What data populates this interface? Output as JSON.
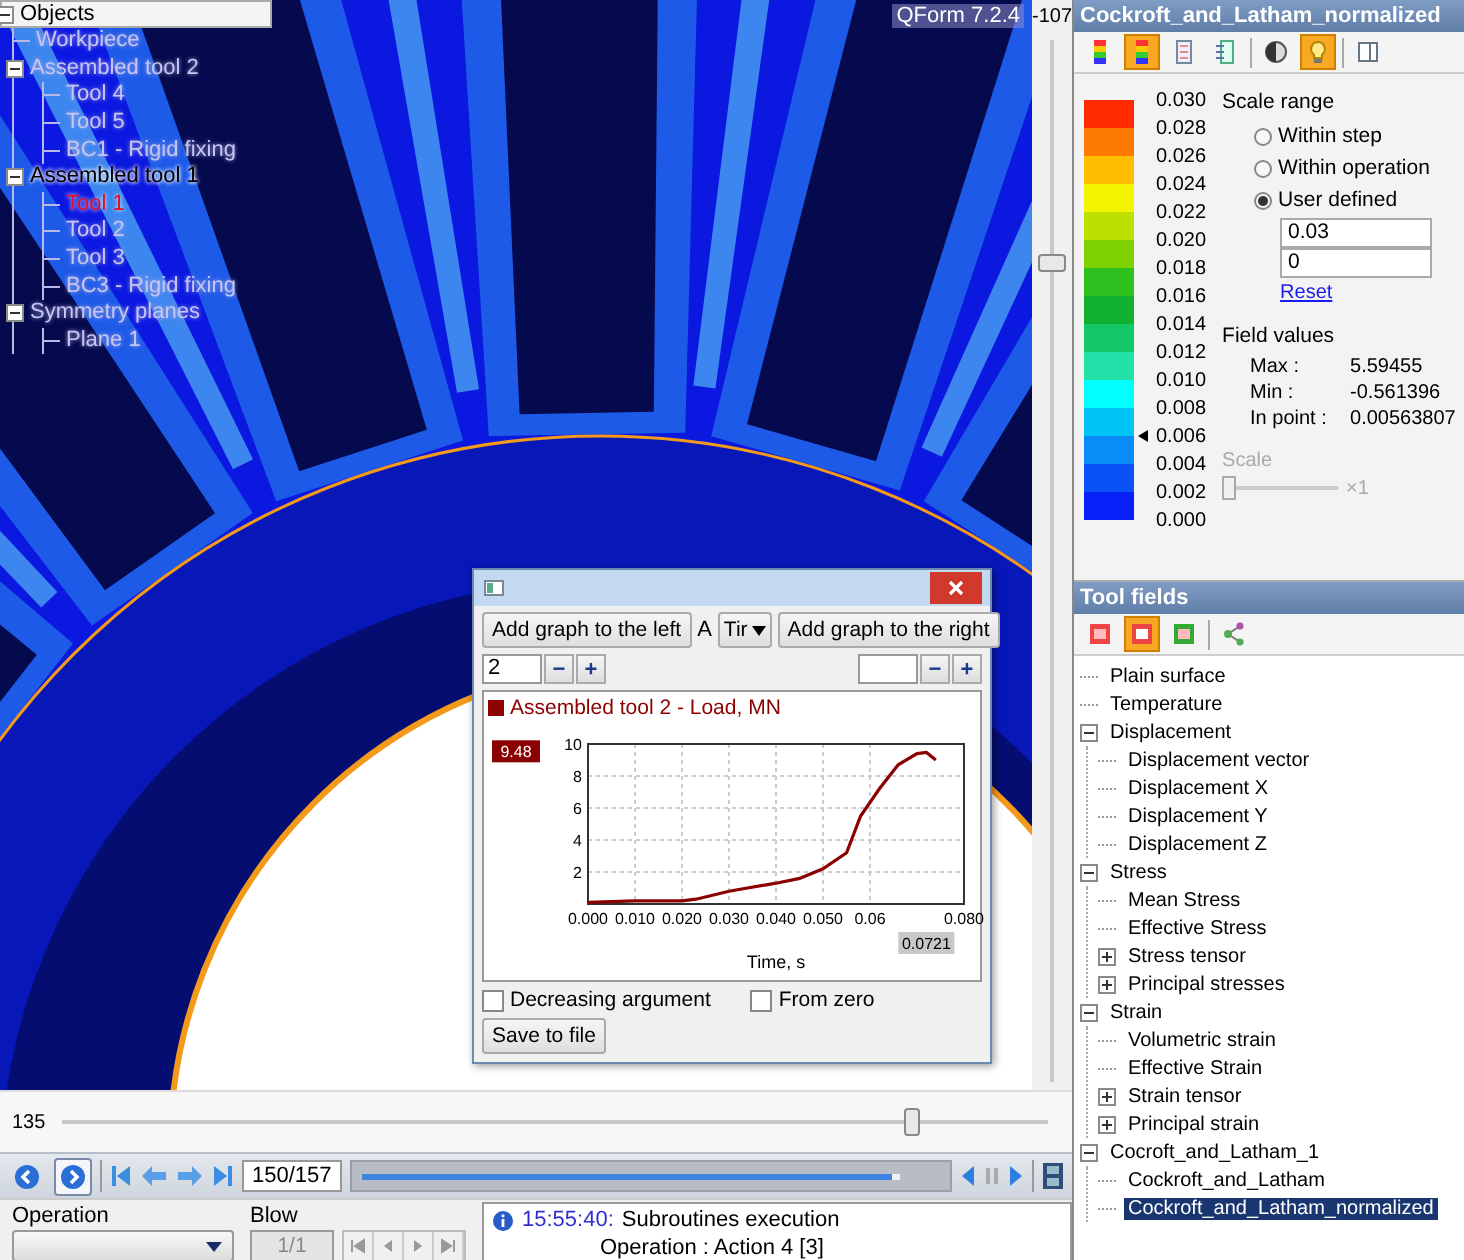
{
  "viewport": {
    "version": "QForm 7.2.4",
    "objects": {
      "title": "Objects",
      "expanded": true,
      "items": [
        {
          "label": "Workpiece",
          "visible": false,
          "selected": false
        },
        {
          "label": "Assembled tool 2",
          "visible": false,
          "selected": false,
          "expanded": true,
          "children": [
            {
              "label": "Tool 4",
              "visible": false,
              "selected": false
            },
            {
              "label": "Tool 5",
              "visible": false,
              "selected": false
            },
            {
              "label": "BC1 - Rigid fixing",
              "visible": false,
              "selected": false
            }
          ]
        },
        {
          "label": "Assembled tool 1",
          "visible": true,
          "selected": false,
          "expanded": true,
          "children": [
            {
              "label": "Tool 1",
              "visible": true,
              "selected": true
            },
            {
              "label": "Tool 2",
              "visible": false,
              "selected": false
            },
            {
              "label": "Tool 3",
              "visible": false,
              "selected": false
            },
            {
              "label": "BC3 - Rigid fixing",
              "visible": false,
              "selected": false
            }
          ]
        },
        {
          "label": "Symmetry planes",
          "visible": false,
          "selected": false,
          "expanded": true,
          "children": [
            {
              "label": "Plane 1",
              "visible": false,
              "selected": false
            }
          ]
        }
      ]
    }
  },
  "vertical_slider": {
    "reading": "-107",
    "level": 0.78
  },
  "dialog": {
    "left_button": "Add graph to the left",
    "right_button": "Add graph to the right",
    "axis_label": "A",
    "axis_select": "Tir",
    "left_spin": {
      "value": "2",
      "minus": "−",
      "plus": "+"
    },
    "right_spin": {
      "minus": "−",
      "plus": "+"
    },
    "chart_data": {
      "type": "line",
      "xlabel": "Time, s",
      "xlim": [
        0,
        0.08
      ],
      "ylim": [
        0,
        10
      ],
      "x": [
        0,
        0.01,
        0.02,
        0.023,
        0.03,
        0.04,
        0.045,
        0.05,
        0.055,
        0.058,
        0.062,
        0.066,
        0.07,
        0.072,
        0.074
      ],
      "series": [
        {
          "name": "Assembled tool 2 - Load, MN",
          "color": "#8b0000",
          "values": [
            0.1,
            0.2,
            0.2,
            0.3,
            0.8,
            1.3,
            1.6,
            2.2,
            3.2,
            5.5,
            7.2,
            8.7,
            9.4,
            9.48,
            9.0
          ]
        }
      ],
      "grid": true,
      "xticks": [
        {
          "value": 0,
          "label": "0.000"
        },
        {
          "value": 0.01,
          "label": "0.010"
        },
        {
          "value": 0.02,
          "label": "0.020"
        },
        {
          "value": 0.03,
          "label": "0.030"
        },
        {
          "value": 0.04,
          "label": "0.040"
        },
        {
          "value": 0.05,
          "label": "0.050"
        },
        {
          "value": 0.06,
          "label": "0.06"
        },
        {
          "value": 0.08,
          "label": "0.080"
        }
      ],
      "yticks": [
        2,
        4,
        6,
        8,
        10
      ],
      "annotations": [
        "9.48",
        "0.0721"
      ]
    },
    "options": [
      {
        "label": "Decreasing argument",
        "checked": false
      },
      {
        "label": "From zero",
        "checked": false
      }
    ],
    "save_button": "Save to file"
  },
  "horizontal_slider": {
    "reading": "135",
    "level": 0.87
  },
  "playback": {
    "nav": [
      {
        "kind": "back",
        "selected": false
      },
      {
        "kind": "forward",
        "selected": true
      }
    ],
    "frame": "150/157",
    "level": 0.93
  },
  "operation": {
    "label": "Operation"
  },
  "blow": {
    "label": "Blow",
    "value": "1/1",
    "disabled": true
  },
  "log": [
    {
      "time": "15:55:40:",
      "message": "Subroutines execution",
      "detail": "Operation : Action 4 [3]"
    }
  ],
  "field_panel": {
    "title": "Cockroft_and_Latham_normalized",
    "toolbar": [
      [
        {
          "kind": "legend-bands",
          "selected": false
        },
        {
          "kind": "legend-bands",
          "selected": true
        },
        {
          "kind": "legend-light",
          "selected": false
        },
        {
          "kind": "legend-lines",
          "selected": false
        }
      ],
      [
        {
          "kind": "contrast",
          "selected": false
        },
        {
          "kind": "bulb",
          "selected": true
        }
      ],
      [
        {
          "kind": "panel",
          "selected": false
        }
      ]
    ],
    "legend": {
      "bands": [
        {
          "color": "#ff2a00"
        },
        {
          "color": "#ff7a00"
        },
        {
          "color": "#ffbf00"
        },
        {
          "color": "#f4f400"
        },
        {
          "color": "#bde000"
        },
        {
          "color": "#7fd000"
        },
        {
          "color": "#2fbf1f"
        },
        {
          "color": "#12b030"
        },
        {
          "color": "#12c866"
        },
        {
          "color": "#22e0a8"
        },
        {
          "color": "#00ffff"
        },
        {
          "color": "#00c4f4"
        },
        {
          "color": "#0a8cf8"
        },
        {
          "color": "#0a52f8"
        },
        {
          "color": "#0a20f8"
        }
      ],
      "labels": [
        {
          "text": "0.030",
          "pointer": false
        },
        {
          "text": "0.028",
          "pointer": false
        },
        {
          "text": "0.026",
          "pointer": false
        },
        {
          "text": "0.024",
          "pointer": false
        },
        {
          "text": "0.022",
          "pointer": false
        },
        {
          "text": "0.020",
          "pointer": false
        },
        {
          "text": "0.018",
          "pointer": false
        },
        {
          "text": "0.016",
          "pointer": false
        },
        {
          "text": "0.014",
          "pointer": false
        },
        {
          "text": "0.012",
          "pointer": false
        },
        {
          "text": "0.010",
          "pointer": false
        },
        {
          "text": "0.008",
          "pointer": false
        },
        {
          "text": "0.006",
          "pointer": true
        },
        {
          "text": "0.004",
          "pointer": false
        },
        {
          "text": "0.002",
          "pointer": false
        },
        {
          "text": "0.000",
          "pointer": false
        }
      ]
    },
    "scale_range": {
      "title": "Scale range",
      "options": [
        {
          "label": "Within step",
          "selected": false
        },
        {
          "label": "Within operation",
          "selected": false
        },
        {
          "label": "User defined",
          "selected": true
        }
      ],
      "max": "0.03",
      "min": "0",
      "reset": "Reset"
    },
    "field_values": {
      "title": "Field values",
      "rows": [
        {
          "label": "Max :",
          "value": "5.59455"
        },
        {
          "label": "Min :",
          "value": "-0.561396"
        },
        {
          "label": "In point :",
          "value": "0.00563807"
        }
      ]
    },
    "scale": {
      "label": "Scale",
      "disabled": true,
      "level": 0,
      "reading": "×1"
    }
  },
  "tool_fields": {
    "title": "Tool fields",
    "toolbar": [
      [
        {
          "kind": "surface-a",
          "selected": false
        },
        {
          "kind": "surface-b",
          "selected": true
        },
        {
          "kind": "surface-c",
          "selected": false
        }
      ],
      [
        {
          "kind": "share",
          "selected": false
        }
      ]
    ],
    "tree": [
      {
        "label": "Plain surface",
        "selected": false
      },
      {
        "label": "Temperature",
        "selected": false
      },
      {
        "label": "Displacement",
        "selected": false,
        "expanded": true,
        "children": [
          {
            "label": "Displacement vector",
            "selected": false
          },
          {
            "label": "Displacement X",
            "selected": false
          },
          {
            "label": "Displacement Y",
            "selected": false
          },
          {
            "label": "Displacement Z",
            "selected": false
          }
        ]
      },
      {
        "label": "Stress",
        "selected": false,
        "expanded": true,
        "children": [
          {
            "label": "Mean Stress",
            "selected": false
          },
          {
            "label": "Effective Stress",
            "selected": false
          },
          {
            "label": "Stress tensor",
            "selected": false,
            "expanded": false
          },
          {
            "label": "Principal stresses",
            "selected": false,
            "expanded": false
          }
        ]
      },
      {
        "label": "Strain",
        "selected": false,
        "expanded": true,
        "children": [
          {
            "label": "Volumetric strain",
            "selected": false
          },
          {
            "label": "Effective Strain",
            "selected": false
          },
          {
            "label": "Strain tensor",
            "selected": false,
            "expanded": false
          },
          {
            "label": "Principal strain",
            "selected": false,
            "expanded": false
          }
        ]
      },
      {
        "label": "Cocroft_and_Latham_1",
        "selected": false,
        "expanded": true,
        "children": [
          {
            "label": "Cockroft_and_Latham",
            "selected": false
          },
          {
            "label": "Cockroft_and_Latham_normalized",
            "selected": true
          }
        ]
      }
    ]
  }
}
